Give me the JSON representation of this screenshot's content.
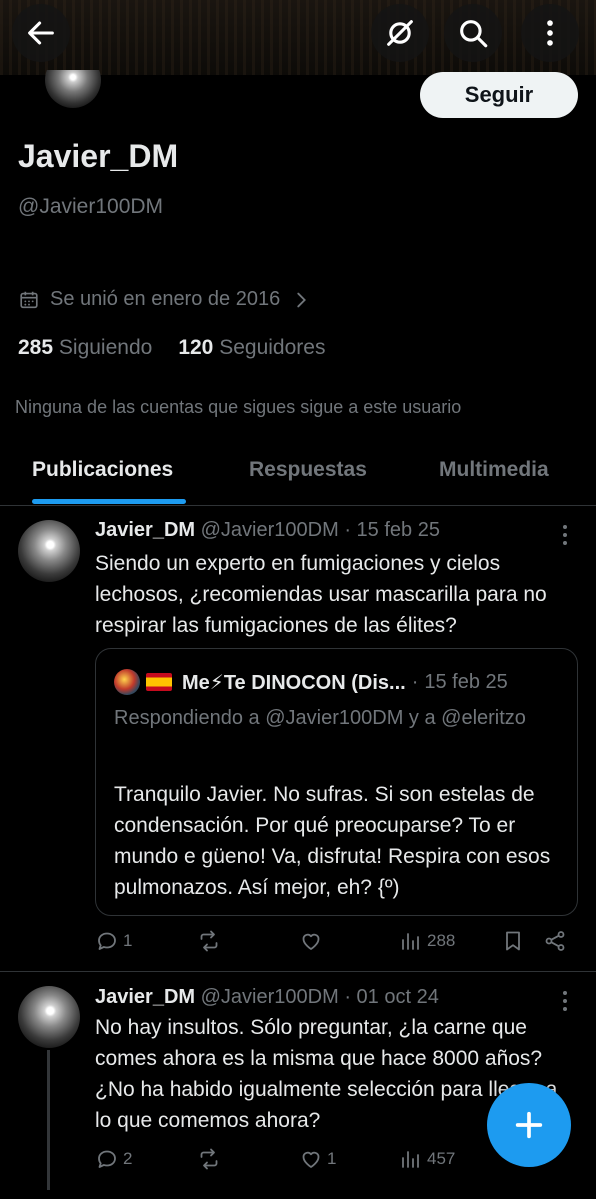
{
  "header": {
    "back_icon": "arrow-left-icon",
    "mute_icon": "slashed-circle-icon",
    "search_icon": "search-icon",
    "more_icon": "more-vertical-icon"
  },
  "profile": {
    "follow_label": "Seguir",
    "name": "Javier_DM",
    "handle": "@Javier100DM",
    "joined": "Se unió en enero de 2016",
    "following_count": "285",
    "following_label": "Siguiendo",
    "followers_count": "120",
    "followers_label": "Seguidores",
    "mutual_note": "Ninguna de las cuentas que sigues sigue a este usuario"
  },
  "tabs": [
    {
      "label": "Publicaciones",
      "active": true
    },
    {
      "label": "Respuestas",
      "active": false
    },
    {
      "label": "Multimedia",
      "active": false
    }
  ],
  "posts": [
    {
      "name": "Javier_DM",
      "handle": "@Javier100DM",
      "date": "15 feb 25",
      "text": "Siendo un experto en fumigaciones y cielos lechosos, ¿recomiendas usar mascarilla para no respirar las fumigaciones de las élites?",
      "quote": {
        "name": "Me⚡Te DINOCON (Dis...",
        "date": "15 feb 25",
        "replying": "Respondiendo a @Javier100DM y a @eleritzo",
        "text": "Tranquilo Javier. No sufras. Si son estelas de condensación. Por qué preocuparse? To er mundo e güeno! Va, disfruta! Respira con esos pulmonazos. Así mejor, eh? {º)"
      },
      "replies": "1",
      "reposts": "",
      "likes": "",
      "views": "288"
    },
    {
      "name": "Javier_DM",
      "handle": "@Javier100DM",
      "date": "01 oct 24",
      "text": "No hay insultos. Sólo preguntar, ¿la carne que comes ahora es la misma que hace 8000 años? ¿No ha habido igualmente selección para llegar a lo que comemos ahora?",
      "replies": "2",
      "reposts": "",
      "likes": "1",
      "views": "457"
    }
  ],
  "fab_icon": "plus-icon",
  "colors": {
    "accent": "#1d9bf0",
    "background": "#000000",
    "muted": "#71767b",
    "text": "#e7e9ea"
  }
}
